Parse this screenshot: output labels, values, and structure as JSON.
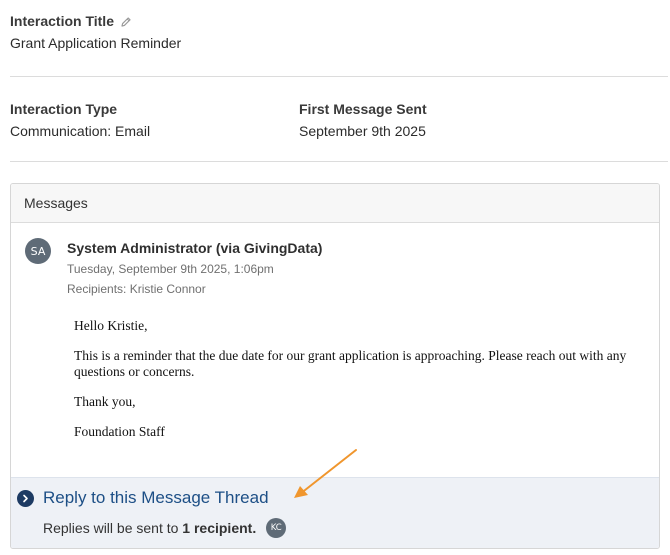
{
  "interaction_title": {
    "label": "Interaction Title",
    "value": "Grant Application Reminder",
    "edit_icon": "pencil-icon"
  },
  "interaction_type": {
    "label": "Interaction Type",
    "value": "Communication: Email"
  },
  "first_message_sent": {
    "label": "First Message Sent",
    "value": "September 9th 2025"
  },
  "messages": {
    "header": "Messages",
    "items": [
      {
        "avatar_initials": "SA",
        "sender": "System Administrator (via GivingData)",
        "timestamp": "Tuesday, September 9th 2025, 1:06pm",
        "recipients": "Recipients: Kristie Connor",
        "body": [
          "Hello Kristie,",
          "This is a reminder that the due date for our grant application is approaching. Please reach out with any questions or concerns.",
          "Thank you,",
          "Foundation Staff"
        ]
      }
    ]
  },
  "reply": {
    "link_text": "Reply to this Message Thread",
    "note_prefix": "Replies will be sent to",
    "note_count": "1 recipient.",
    "recipient_initials": "KC",
    "icon": "chevron-right-circle-icon"
  },
  "colors": {
    "accent": "#1d4f86",
    "annotation_arrow": "#f0962d",
    "avatar": "#5f6b77"
  }
}
